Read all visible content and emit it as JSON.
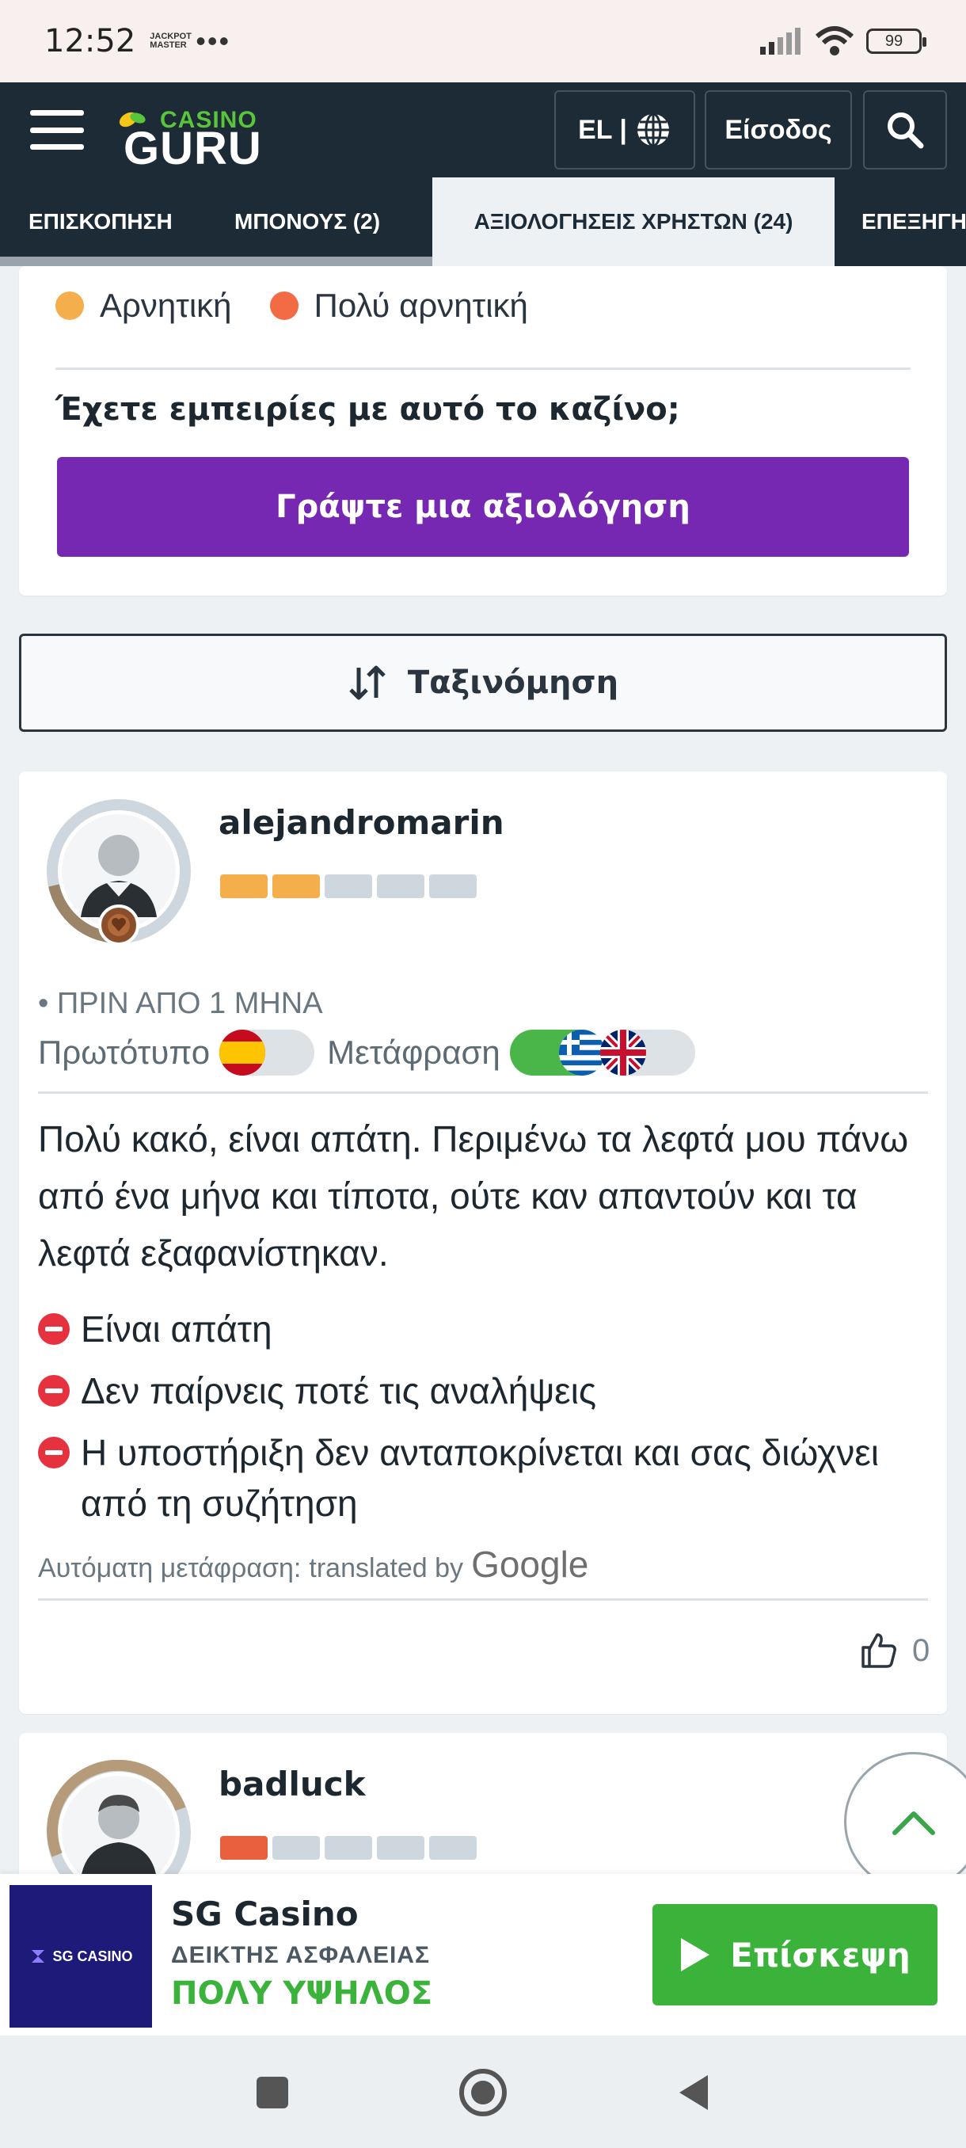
{
  "status_bar": {
    "time": "12:52",
    "mini_logo": "JACKPOT MASTER",
    "dots": "•••",
    "battery": "99"
  },
  "header": {
    "logo_casino": "CASINO",
    "logo_guru": "GURU",
    "lang": "EL |",
    "login": "Είσοδος"
  },
  "tabs": [
    {
      "label": "ΕΠΙΣΚΟΠΗΣΗ",
      "active": false
    },
    {
      "label": "ΜΠΟΝΟΥΣ  (2)",
      "active": false
    },
    {
      "label": "ΑΞΙΟΛΟΓΗΣΕΙΣ ΧΡΗΣΤΩΝ (24)",
      "active": true
    },
    {
      "label": "ΕΠΕΞΗΓΗ",
      "active": false
    }
  ],
  "summary": {
    "legend": [
      {
        "label": "Αρνητική",
        "color": "#f5ae4c"
      },
      {
        "label": "Πολύ αρνητική",
        "color": "#f26b45"
      }
    ],
    "question": "Έχετε εμπειρίες με αυτό το καζίνο;",
    "write_button": "Γράψτε μια αξιολόγηση"
  },
  "sort": {
    "label": "Ταξινόμηση"
  },
  "review": {
    "username": "alejandromarin",
    "rating_bars_filled": 2,
    "rating_color": "#f5ae4c",
    "date": "• ΠΡΙΝ ΑΠΟ 1 ΜΗΝΑ",
    "original_label": "Πρωτότυπο",
    "translation_label": "Μετάφραση",
    "text": "Πολύ κακό, είναι απάτη. Περιμένω τα λεφτά μου πάνω από ένα μήνα και τίποτα, ούτε καν απαντούν και τα λεφτά εξαφανίστηκαν.",
    "cons": [
      "Είναι απάτη",
      "Δεν παίρνεις ποτέ τις αναλήψεις",
      "Η υποστήριξη δεν ανταποκρίνεται και σας διώχνει από τη συζήτηση"
    ],
    "auto_translation": "Αυτόματη μετάφραση:",
    "translated_by": "translated by",
    "google": "Google",
    "likes": "0"
  },
  "next_review": {
    "username": "badluck",
    "rating_bars_filled": 1,
    "rating_color": "#e8603e"
  },
  "casino_bar": {
    "logo_text": "SG CASINO",
    "name": "SG Casino",
    "safety_label": "ΔΕΙΚΤΗΣ ΑΣΦΑΛΕΙΑΣ",
    "safety_level": "ΠΟΛΥ ΥΨΗΛΟΣ",
    "visit_button": "Επίσκεψη"
  },
  "colors": {
    "header_bg": "#1c2b36",
    "accent_purple": "#7628b3",
    "green": "#3bb33b",
    "minus_red": "#e5323e"
  }
}
